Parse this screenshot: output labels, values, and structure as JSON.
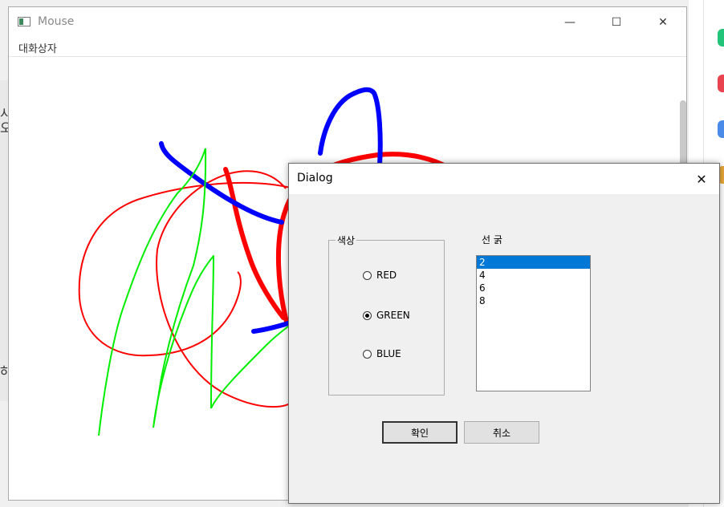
{
  "main_window": {
    "title": "Mouse",
    "menu": [
      "대화상자"
    ],
    "controls": {
      "minimize": "—",
      "maximize": "☐",
      "close": "✕"
    }
  },
  "background": {
    "left_chars": [
      "시",
      "오",
      "하"
    ],
    "right_icon_colors": [
      "#22c47a",
      "#e8434f",
      "#4a8ae8",
      "#e8a93a"
    ]
  },
  "drawing_strokes": [
    {
      "color": "#ff0000",
      "width": 2
    },
    {
      "color": "#ff0000",
      "width": 6
    },
    {
      "color": "#0000ff",
      "width": 6
    },
    {
      "color": "#00ee00",
      "width": 2
    }
  ],
  "dialog": {
    "title": "Dialog",
    "close": "✕",
    "color_group": {
      "label": "색상",
      "options": [
        {
          "label": "RED",
          "checked": false
        },
        {
          "label": "GREEN",
          "checked": true
        },
        {
          "label": "BLUE",
          "checked": false
        }
      ]
    },
    "line_width": {
      "label": "선 굵",
      "items": [
        "2",
        "4",
        "6",
        "8"
      ],
      "selected": "2"
    },
    "ok_label": "확인",
    "cancel_label": "취소"
  }
}
